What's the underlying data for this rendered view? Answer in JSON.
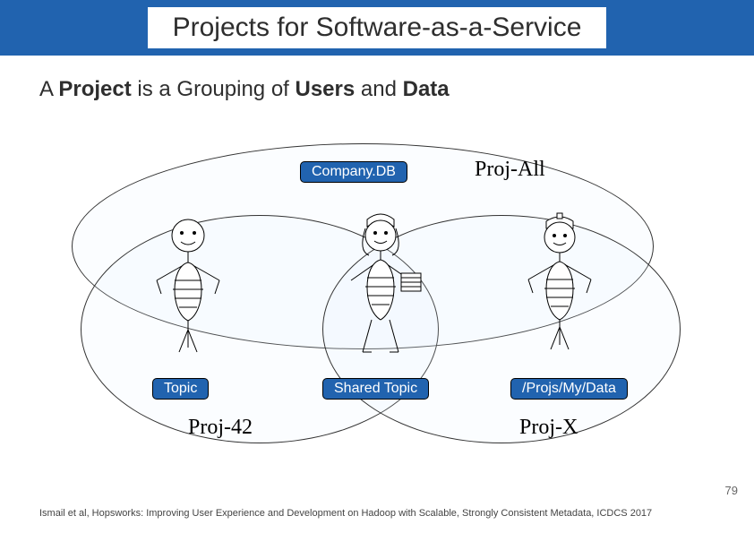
{
  "title": "Projects for Software-as-a-Service",
  "subtitle_parts": [
    "A ",
    "Project",
    " is a Grouping of ",
    "Users",
    " and ",
    "Data"
  ],
  "projects": {
    "all_label": "Proj-All",
    "p42_label": "Proj-42",
    "px_label": "Proj-X"
  },
  "chips": {
    "company": "Company.DB",
    "topic": "Topic",
    "shared": "Shared Topic",
    "projs_path": "/Projs/My/Data"
  },
  "page_number": "79",
  "citation": "Ismail et al, Hopsworks: Improving User Experience and Development on Hadoop with Scalable, Strongly Consistent Metadata, ICDCS 2017"
}
